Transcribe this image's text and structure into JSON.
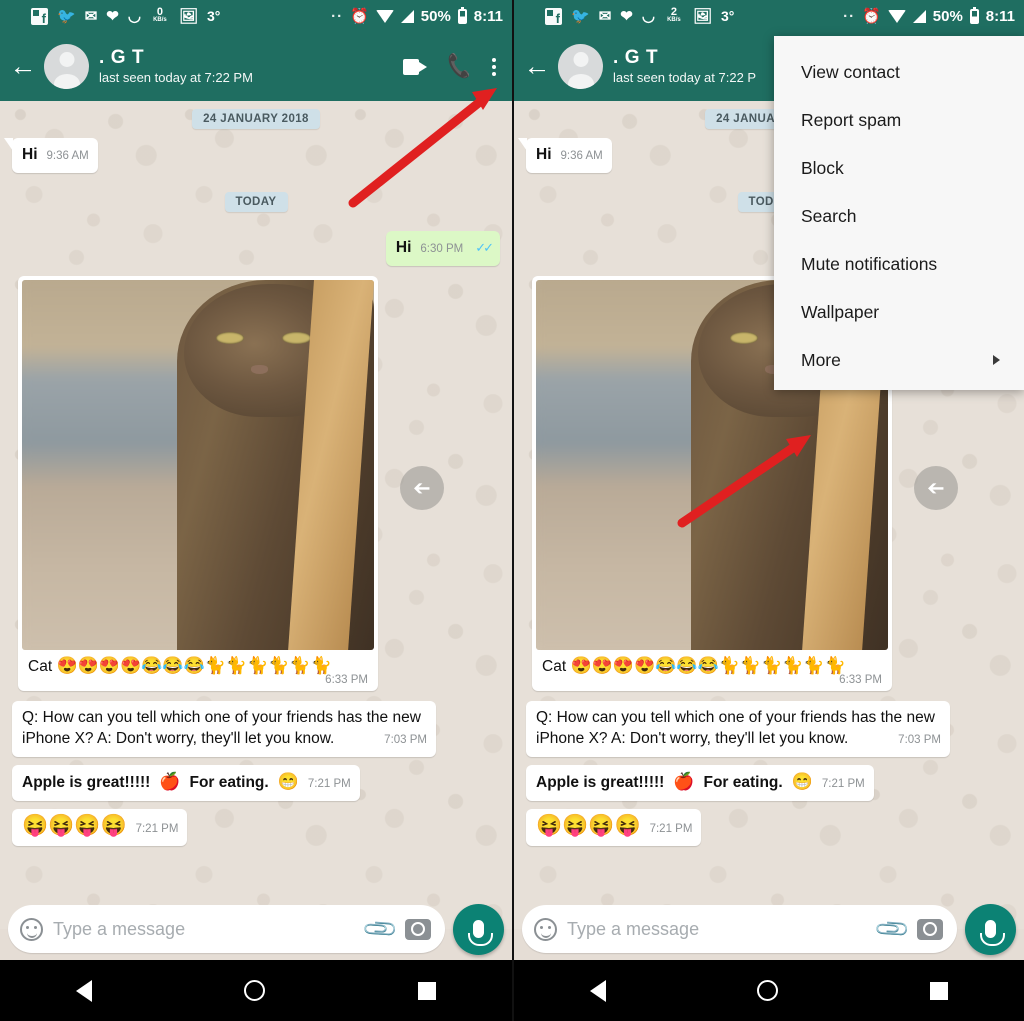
{
  "statusbar": {
    "icons": [
      "facebook-messenger-icon",
      "twitter-icon",
      "gmail-icon",
      "heart-icon",
      "moustache-icon",
      "data-speed-icon",
      "photos-icon"
    ],
    "data_speed_value": "0",
    "data_speed_unit": "KB/s",
    "temperature": "3°",
    "more_dots": "··",
    "alarm": "⏰",
    "battery_percent": "50%",
    "time": "8:11"
  },
  "header": {
    "back_label": "←",
    "contact_name": ". G T",
    "status": "last seen today at 7:22 PM",
    "status_truncated": "last seen today at 7:22 P",
    "video_call": "video-call",
    "voice_call": "voice-call",
    "overflow": "more-options"
  },
  "menu": {
    "items": [
      {
        "label": "View contact",
        "has_submenu": false
      },
      {
        "label": "Report spam",
        "has_submenu": false
      },
      {
        "label": "Block",
        "has_submenu": false
      },
      {
        "label": "Search",
        "has_submenu": false
      },
      {
        "label": "Mute notifications",
        "has_submenu": false
      },
      {
        "label": "Wallpaper",
        "has_submenu": false
      },
      {
        "label": "More",
        "has_submenu": true
      }
    ]
  },
  "chat": {
    "date_divider_1": "24 JANUARY 2018",
    "date_divider_2": "TODAY",
    "messages": [
      {
        "id": "m1",
        "dir": "in",
        "text": "Hi",
        "time": "9:36 AM"
      },
      {
        "id": "m2",
        "dir": "out",
        "text": "Hi",
        "time": "6:30 PM",
        "ticks": "✓✓"
      },
      {
        "id": "m3",
        "dir": "in",
        "type": "image",
        "caption_text": "Cat",
        "caption_emoji": "😍😍😍😍😂😂😂🐈🐈🐈🐈🐈🐈",
        "time": "6:33 PM",
        "forward": "forward-button"
      },
      {
        "id": "m4",
        "dir": "in",
        "text": "Q: How can you tell which one of your friends has the new iPhone X? A: Don't worry, they'll let you know.",
        "time": "7:03 PM"
      },
      {
        "id": "m5",
        "dir": "in",
        "text": "Apple is great!!!!!",
        "emoji_inline": "🍎",
        "text2": "For eating.",
        "emoji_end": "😁",
        "time": "7:21 PM"
      },
      {
        "id": "m6",
        "dir": "in",
        "text": "",
        "emoji_only": "😝😝😝😝",
        "time": "7:21 PM"
      }
    ]
  },
  "composer": {
    "placeholder": "Type a message",
    "emoji_button": "emoji",
    "attach_button": "attach",
    "camera_button": "camera",
    "mic_button": "voice-record"
  },
  "navbar": {
    "back": "back",
    "home": "home",
    "recents": "recents"
  },
  "colors": {
    "header_green": "#1f6e61",
    "outgoing_bubble": "#dcf8c6",
    "incoming_bubble": "#ffffff",
    "chat_background": "#e7e0d8",
    "date_chip": "#cfe0e8",
    "accent_fab": "#0c8274",
    "annotation_arrow": "#e02020",
    "tick_blue": "#4fc3f7"
  },
  "annotations": [
    {
      "id": "a1",
      "panel": "left",
      "points_to": "overflow-menu-button",
      "color": "#e02020"
    },
    {
      "id": "a2",
      "panel": "right",
      "points_to": "menu-item-more",
      "color": "#e02020"
    }
  ]
}
